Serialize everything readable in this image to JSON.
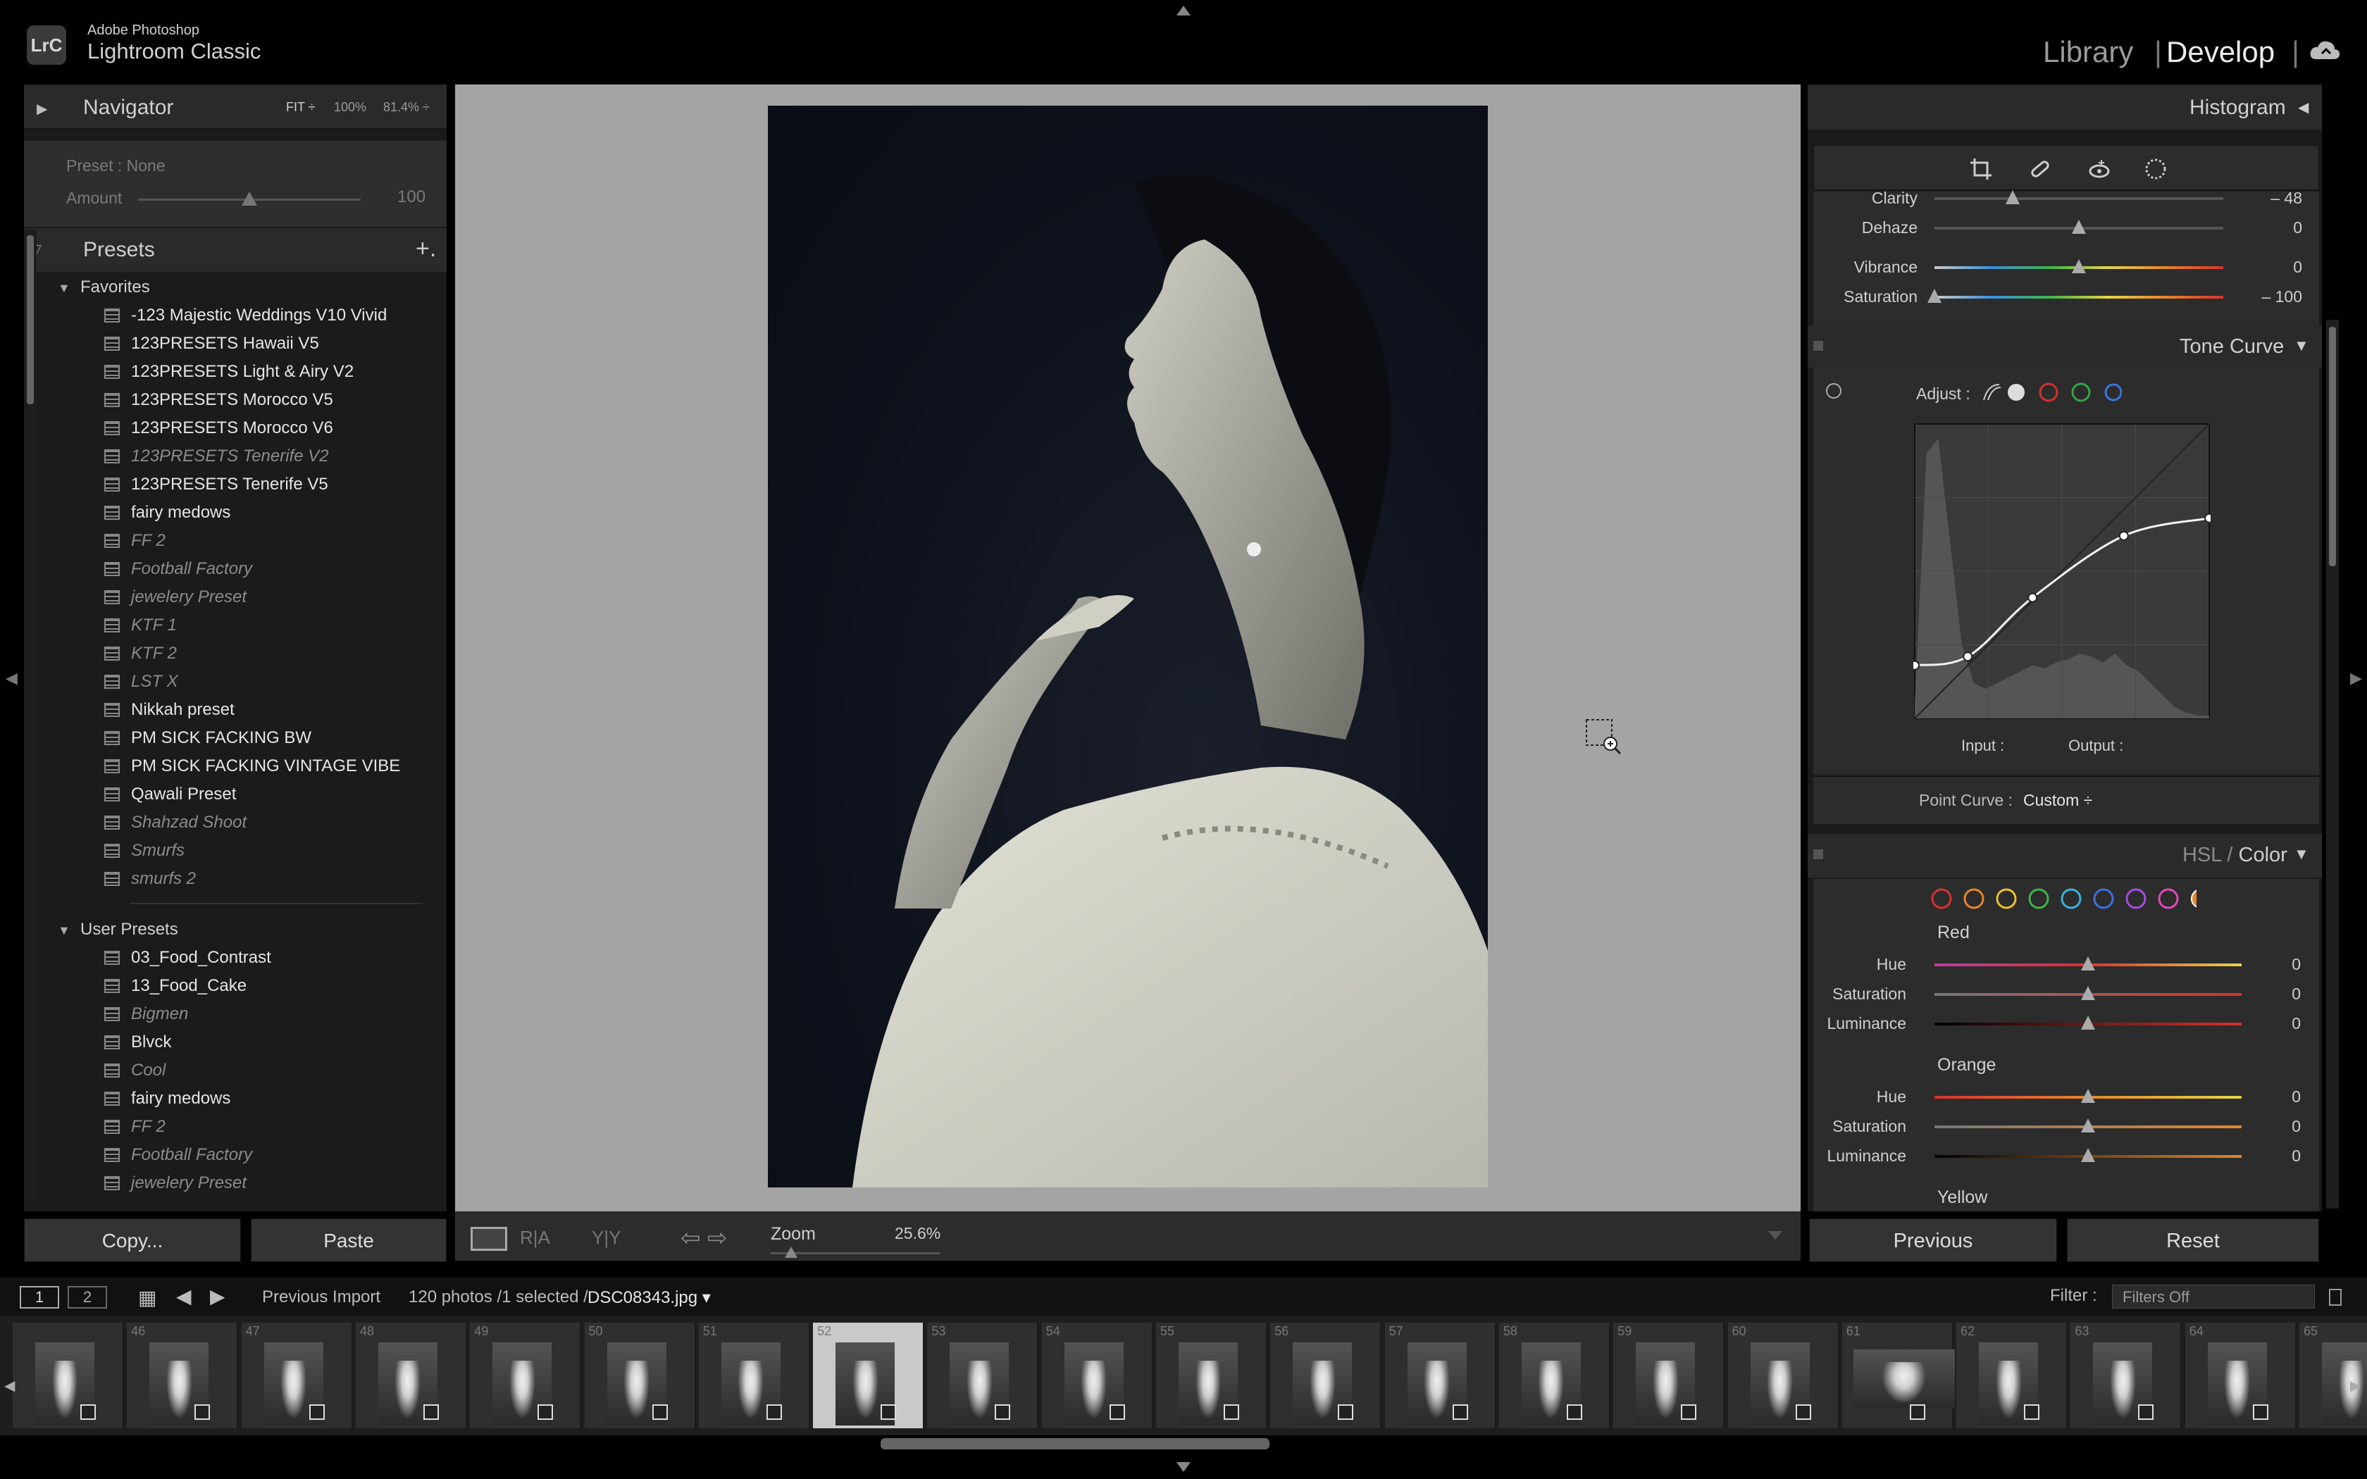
{
  "app": {
    "logo": "LrC",
    "company": "Adobe Photoshop",
    "product": "Lightroom Classic",
    "modules": [
      "Library",
      "Develop"
    ],
    "module_sep": "|",
    "active_module": "Develop"
  },
  "navigator": {
    "title": "Navigator",
    "zoom_fit": "FIT ÷",
    "zoom_100": "100%",
    "zoom_custom": "81.4% ÷",
    "preset_label": "Preset : None",
    "amount_label": "Amount",
    "amount_value": "100",
    "amount_level": 0.5
  },
  "presets": {
    "title": "Presets",
    "add": "+.",
    "favorites_label": "Favorites",
    "favorites": [
      {
        "name": "-123 Majestic Weddings V10 Vivid",
        "dim": false
      },
      {
        "name": "123PRESETS Hawaii V5",
        "dim": false
      },
      {
        "name": "123PRESETS Light & Airy V2",
        "dim": false
      },
      {
        "name": "123PRESETS Morocco V5",
        "dim": false
      },
      {
        "name": "123PRESETS Morocco V6",
        "dim": false
      },
      {
        "name": "123PRESETS Tenerife V2",
        "dim": true
      },
      {
        "name": "123PRESETS Tenerife V5",
        "dim": false
      },
      {
        "name": "fairy medows",
        "dim": false
      },
      {
        "name": "FF 2",
        "dim": true
      },
      {
        "name": "Football Factory",
        "dim": true
      },
      {
        "name": "jewelery Preset",
        "dim": true
      },
      {
        "name": "KTF 1",
        "dim": true
      },
      {
        "name": "KTF 2",
        "dim": true
      },
      {
        "name": "LST X",
        "dim": true
      },
      {
        "name": "Nikkah preset",
        "dim": false
      },
      {
        "name": "PM SICK FACKING BW",
        "dim": false
      },
      {
        "name": "PM SICK FACKING VINTAGE VIBE",
        "dim": false
      },
      {
        "name": "Qawali Preset",
        "dim": false
      },
      {
        "name": "Shahzad Shoot",
        "dim": true
      },
      {
        "name": "Smurfs",
        "dim": true
      },
      {
        "name": "smurfs 2",
        "dim": true
      }
    ],
    "user_label": "User Presets",
    "user": [
      {
        "name": "03_Food_Contrast",
        "dim": false
      },
      {
        "name": "13_Food_Cake",
        "dim": false
      },
      {
        "name": "Bigmen",
        "dim": true
      },
      {
        "name": "Blvck",
        "dim": false
      },
      {
        "name": "Cool",
        "dim": true
      },
      {
        "name": "fairy medows",
        "dim": false
      },
      {
        "name": "FF 2",
        "dim": true
      },
      {
        "name": "Football Factory",
        "dim": true
      },
      {
        "name": "jewelery Preset",
        "dim": true
      }
    ]
  },
  "left_buttons": {
    "copy": "Copy...",
    "paste": "Paste"
  },
  "toolbar": {
    "ra": "R|A",
    "yy": "Y|Y",
    "nav_arrows": "⇦ ⇨",
    "zoom_label": "Zoom",
    "zoom_value": "25.6%",
    "zoom_level": 0.12
  },
  "histogram": {
    "title": "Histogram"
  },
  "tools": [
    "crop-tool",
    "healing-tool",
    "redeye-tool",
    "masking-tool"
  ],
  "basic": {
    "rows": [
      {
        "label": "Clarity",
        "value": "– 48",
        "level": 0.27
      },
      {
        "label": "Dehaze",
        "value": "0",
        "level": 0.5
      },
      {
        "label": "Vibrance",
        "value": "0",
        "level": 0.5
      },
      {
        "label": "Saturation",
        "value": "– 100",
        "level": 0.0
      }
    ]
  },
  "tone_curve": {
    "title": "Tone Curve",
    "adjust_label": "Adjust :",
    "input_label": "Input :",
    "output_label": "Output :",
    "point_curve_label": "Point Curve :",
    "point_curve_value": "Custom ÷",
    "points": [
      [
        0,
        0.18
      ],
      [
        0.18,
        0.21
      ],
      [
        0.4,
        0.41
      ],
      [
        0.71,
        0.62
      ],
      [
        1.0,
        0.68
      ]
    ]
  },
  "hsl": {
    "title": "HSL / Color",
    "title_hsl": "HSL",
    "title_sep": " / ",
    "title_color": "Color",
    "swatches": [
      "#d8322e",
      "#e5862a",
      "#e8c32e",
      "#3fb44a",
      "#3ab4d8",
      "#3f6fe0",
      "#a24ee0",
      "#dc4bb8"
    ],
    "sections": [
      {
        "name": "Red",
        "rows": [
          {
            "label": "Hue",
            "value": "0",
            "level": 0.5
          },
          {
            "label": "Saturation",
            "value": "0",
            "level": 0.5
          },
          {
            "label": "Luminance",
            "value": "0",
            "level": 0.5
          }
        ]
      },
      {
        "name": "Orange",
        "rows": [
          {
            "label": "Hue",
            "value": "0",
            "level": 0.5
          },
          {
            "label": "Saturation",
            "value": "0",
            "level": 0.5
          },
          {
            "label": "Luminance",
            "value": "0",
            "level": 0.5
          }
        ]
      },
      {
        "name": "Yellow",
        "rows": []
      }
    ]
  },
  "right_buttons": {
    "previous": "Previous",
    "reset": "Reset"
  },
  "filmstrip_bar": {
    "view1": "1",
    "view2": "2",
    "source": "Previous Import",
    "count": "120 photos /1 selected /",
    "file": "DSC08343.jpg ▾",
    "filter_label": "Filter :",
    "filter_value": "Filters Off"
  },
  "filmstrip": [
    {
      "num": "",
      "selected": false,
      "wide": false
    },
    {
      "num": "46",
      "selected": false,
      "wide": false
    },
    {
      "num": "47",
      "selected": false,
      "wide": false
    },
    {
      "num": "48",
      "selected": false,
      "wide": false
    },
    {
      "num": "49",
      "selected": false,
      "wide": false
    },
    {
      "num": "50",
      "selected": false,
      "wide": false
    },
    {
      "num": "51",
      "selected": false,
      "wide": false
    },
    {
      "num": "52",
      "selected": true,
      "wide": false
    },
    {
      "num": "53",
      "selected": false,
      "wide": false
    },
    {
      "num": "54",
      "selected": false,
      "wide": false
    },
    {
      "num": "55",
      "selected": false,
      "wide": false
    },
    {
      "num": "56",
      "selected": false,
      "wide": false
    },
    {
      "num": "57",
      "selected": false,
      "wide": false
    },
    {
      "num": "58",
      "selected": false,
      "wide": false
    },
    {
      "num": "59",
      "selected": false,
      "wide": false
    },
    {
      "num": "60",
      "selected": false,
      "wide": false
    },
    {
      "num": "61",
      "selected": false,
      "wide": true
    },
    {
      "num": "62",
      "selected": false,
      "wide": false
    },
    {
      "num": "63",
      "selected": false,
      "wide": false
    },
    {
      "num": "64",
      "selected": false,
      "wide": false
    },
    {
      "num": "65",
      "selected": false,
      "wide": false
    }
  ]
}
